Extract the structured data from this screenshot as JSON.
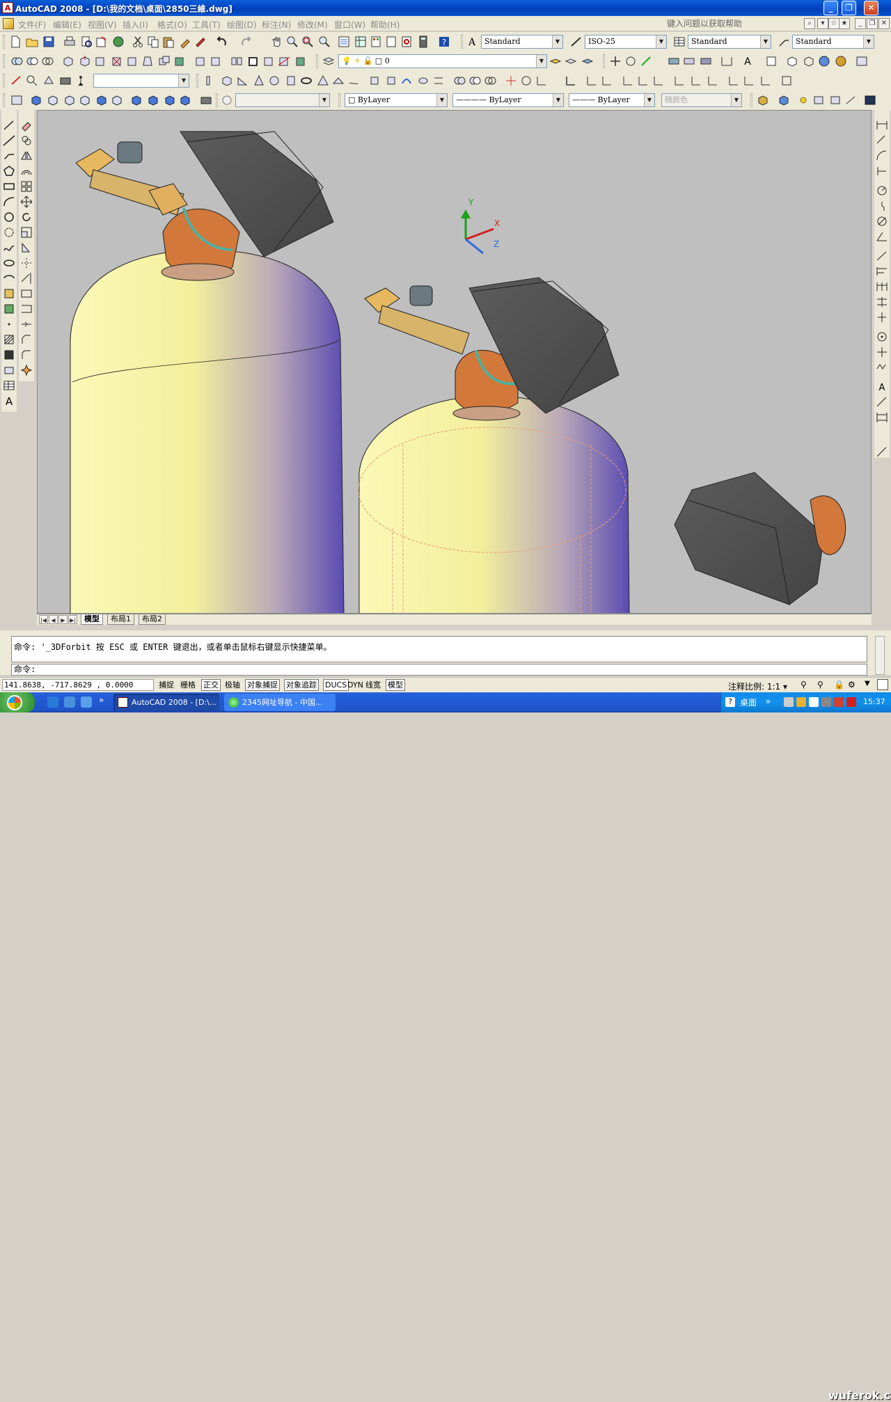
{
  "window": {
    "app_icon": "A",
    "title": "AutoCAD 2008 - [D:\\我的文档\\桌面\\2850三維.dwg]",
    "controls": [
      "minimize-icon",
      "restore-icon",
      "close-icon"
    ]
  },
  "menubar": {
    "items": [
      "文件(F)",
      "编辑(E)",
      "视图(V)",
      "插入(I)",
      "格式(O)",
      "工具(T)",
      "绘图(D)",
      "标注(N)",
      "修改(M)",
      "窗口(W)",
      "帮助(H)"
    ],
    "help_placeholder": "键入问题以获取帮助"
  },
  "toolbars": {
    "text_style": "Standard",
    "dim_style": "ISO-25",
    "table_style": "Standard",
    "mleader_style": "Standard",
    "layer": "0",
    "color": "ByLayer",
    "linetype": "ByLayer",
    "lineweight": "ByLayer",
    "plotstyle": "随颜色"
  },
  "viewport": {
    "ucs_labels": {
      "x": "X",
      "y": "Y",
      "z": "Z"
    },
    "colors": {
      "background": "#bfbfbf",
      "tank": "#f2ef9a",
      "tank_shade": "#5f4fb0",
      "housing": "#505050",
      "valve": "#d2783a",
      "pipe": "#d8b46a"
    }
  },
  "layout_tabs": [
    "模型",
    "布局1",
    "布局2"
  ],
  "command": {
    "history_line": "命令: '_3DForbit 按 ESC 或 ENTER 键退出，或者单击鼠标右键显示快捷菜单。",
    "prompt": "命令:"
  },
  "statusbar": {
    "coordinates": "141.8638,   -717.8629 , 0.0000",
    "toggles": [
      {
        "label": "捕捉",
        "on": false
      },
      {
        "label": "栅格",
        "on": false
      },
      {
        "label": "正交",
        "on": true
      },
      {
        "label": "极轴",
        "on": false
      },
      {
        "label": "对象捕捉",
        "on": true
      },
      {
        "label": "对象追踪",
        "on": true
      },
      {
        "label": "DUCS",
        "on": true
      },
      {
        "label": "DYN",
        "on": false
      },
      {
        "label": "线宽",
        "on": false
      },
      {
        "label": "模型",
        "on": true
      }
    ],
    "annotation_scale_label": "注释比例:",
    "annotation_scale_value": "1:1"
  },
  "taskbar": {
    "items": [
      {
        "label": "AutoCAD 2008 - [D:\\...",
        "active": true
      },
      {
        "label": "2345网址导航 - 中国...",
        "active": false
      }
    ],
    "desktop_label": "桌面",
    "clock": "15:37"
  },
  "watermark": "wuferok.com"
}
